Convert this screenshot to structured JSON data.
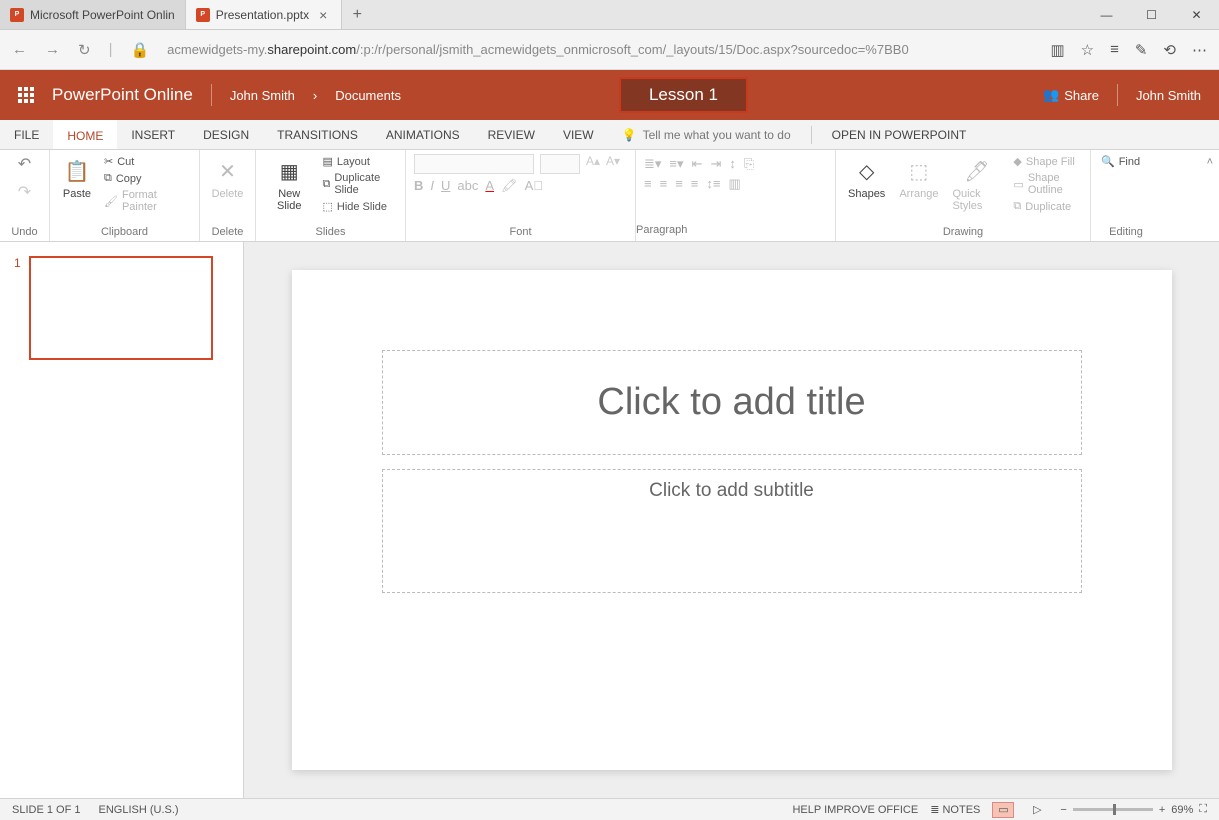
{
  "browser": {
    "tabs": [
      {
        "label": "Microsoft PowerPoint Onlin"
      },
      {
        "label": "Presentation.pptx"
      }
    ],
    "url_pre": "acmewidgets-my.",
    "url_dark": "sharepoint.com",
    "url_post": "/:p:/r/personal/jsmith_acmewidgets_onmicrosoft_com/_layouts/15/Doc.aspx?sourcedoc=%7BB0"
  },
  "brand": {
    "app": "PowerPoint Online",
    "user": "John Smith",
    "crumb_sep": "›",
    "crumb2": "Documents",
    "doc_title": "Lesson 1",
    "share": "Share",
    "username": "John Smith"
  },
  "tabs": {
    "file": "FILE",
    "home": "HOME",
    "insert": "INSERT",
    "design": "DESIGN",
    "transitions": "TRANSITIONS",
    "animations": "ANIMATIONS",
    "review": "REVIEW",
    "view": "VIEW",
    "tell_me": "Tell me what you want to do",
    "open_in": "OPEN IN POWERPOINT"
  },
  "ribbon": {
    "undo": "Undo",
    "paste": "Paste",
    "cut": "Cut",
    "copy": "Copy",
    "fmt": "Format Painter",
    "clipboard": "Clipboard",
    "delete": "Delete",
    "delete_grp": "Delete",
    "newslide": "New Slide",
    "layout": "Layout",
    "dup": "Duplicate Slide",
    "hide": "Hide Slide",
    "slides": "Slides",
    "font": "Font",
    "paragraph": "Paragraph",
    "shapes": "Shapes",
    "arrange": "Arrange",
    "quick": "Quick Styles",
    "shapefill": "Shape Fill",
    "shapeout": "Shape Outline",
    "duplicate": "Duplicate",
    "drawing": "Drawing",
    "find": "Find",
    "editing": "Editing"
  },
  "slide": {
    "num": "1",
    "title_ph": "Click to add title",
    "sub_ph": "Click to add subtitle"
  },
  "status": {
    "slide": "SLIDE 1 OF 1",
    "lang": "ENGLISH (U.S.)",
    "help": "HELP IMPROVE OFFICE",
    "notes": "NOTES",
    "zoom": "69%"
  }
}
